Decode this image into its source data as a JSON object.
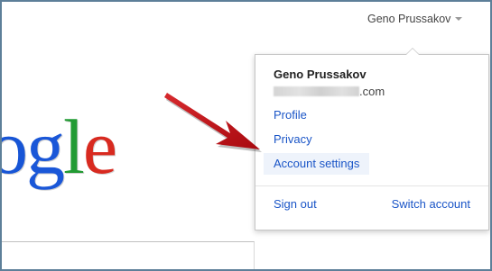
{
  "header": {
    "account_name": "Geno Prussakov",
    "caret_icon": "caret-down-icon"
  },
  "logo": {
    "letters": [
      {
        "char": "o",
        "color": "#1755d6"
      },
      {
        "char": "g",
        "color": "#1a57d8"
      },
      {
        "char": "l",
        "color": "#229b33"
      },
      {
        "char": "e",
        "color": "#d82a20"
      }
    ]
  },
  "search": {
    "value": ""
  },
  "account_menu": {
    "user_name": "Geno Prussakov",
    "email_suffix": ".com",
    "items": [
      {
        "label": "Profile"
      },
      {
        "label": "Privacy"
      },
      {
        "label": "Account settings",
        "highlighted": true
      }
    ],
    "footer": {
      "sign_out": "Sign out",
      "switch_account": "Switch account"
    }
  },
  "annotation": {
    "arrow_color": "#c8181d",
    "arrow_icon": "red-arrow-icon"
  },
  "colors": {
    "link": "#1a55c7",
    "frame_border": "#5d7f99",
    "highlight": "#eef3fb"
  }
}
